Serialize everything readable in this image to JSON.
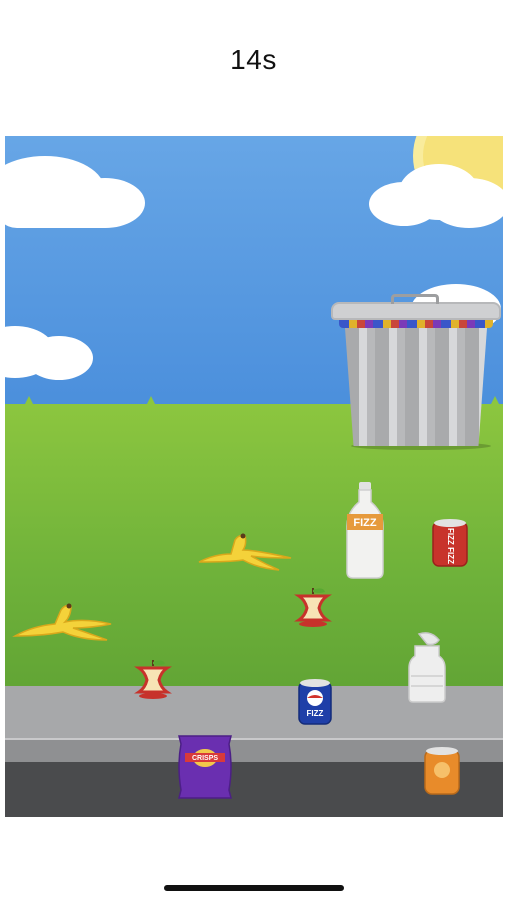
{
  "timer": {
    "text": "14s"
  },
  "game": {
    "scene": "park-litter-pickup",
    "bin": {
      "icon": "trash-bin-icon"
    },
    "items": [
      {
        "id": "banana-peel-1",
        "icon": "banana-peel-icon"
      },
      {
        "id": "banana-peel-2",
        "icon": "banana-peel-icon"
      },
      {
        "id": "soda-bottle",
        "icon": "bottle-icon",
        "label": "FIZZ"
      },
      {
        "id": "red-can",
        "icon": "can-icon",
        "label": "FIZZ FIZZ"
      },
      {
        "id": "apple-core-1",
        "icon": "apple-core-icon"
      },
      {
        "id": "apple-core-2",
        "icon": "apple-core-icon"
      },
      {
        "id": "milk-bottle",
        "icon": "milk-bottle-icon"
      },
      {
        "id": "blue-can",
        "icon": "can-icon",
        "label": "FIZZ"
      },
      {
        "id": "crisps-packet",
        "icon": "crisps-packet-icon",
        "label": "CRISPS"
      },
      {
        "id": "orange-can",
        "icon": "can-icon"
      }
    ]
  },
  "colors": {
    "sky": "#5a9ae1",
    "grass": "#7cbd3c",
    "pavement": "#a7a8aa",
    "road": "#4a4b4d"
  }
}
